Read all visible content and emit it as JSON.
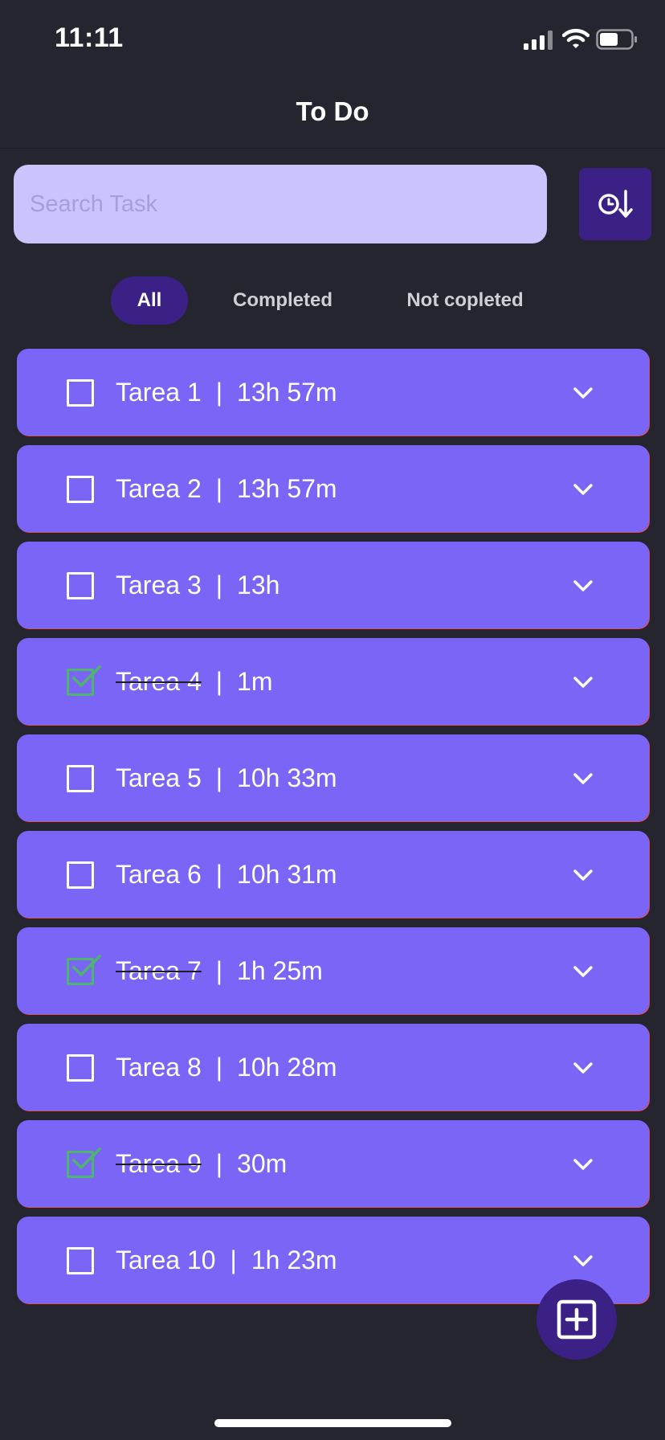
{
  "status_bar": {
    "time": "11:11"
  },
  "header": {
    "title": "To Do"
  },
  "search": {
    "placeholder": "Search Task",
    "value": ""
  },
  "sort": {
    "icon": "clock-sort-down-icon"
  },
  "filters": {
    "all": "All",
    "completed": "Completed",
    "not_completed": "Not copleted",
    "active": "all"
  },
  "separator": "|",
  "tasks": [
    {
      "name": "Tarea 1",
      "duration": "13h 57m",
      "completed": false
    },
    {
      "name": "Tarea 2",
      "duration": "13h 57m",
      "completed": false
    },
    {
      "name": "Tarea 3",
      "duration": "13h",
      "completed": false
    },
    {
      "name": "Tarea 4",
      "duration": "1m",
      "completed": true
    },
    {
      "name": "Tarea 5",
      "duration": "10h 33m",
      "completed": false
    },
    {
      "name": "Tarea 6",
      "duration": "10h 31m",
      "completed": false
    },
    {
      "name": "Tarea 7",
      "duration": "1h 25m",
      "completed": true
    },
    {
      "name": "Tarea 8",
      "duration": "10h 28m",
      "completed": false
    },
    {
      "name": "Tarea 9",
      "duration": "30m",
      "completed": true
    },
    {
      "name": "Tarea 10",
      "duration": "1h 23m",
      "completed": false
    }
  ],
  "fab": {
    "icon": "add-square-icon"
  },
  "colors": {
    "background": "#25252f",
    "card": "#7b65f6",
    "accent": "#3b2185",
    "search_bg": "#cbc3fb",
    "check_green": "#4eb56f"
  }
}
